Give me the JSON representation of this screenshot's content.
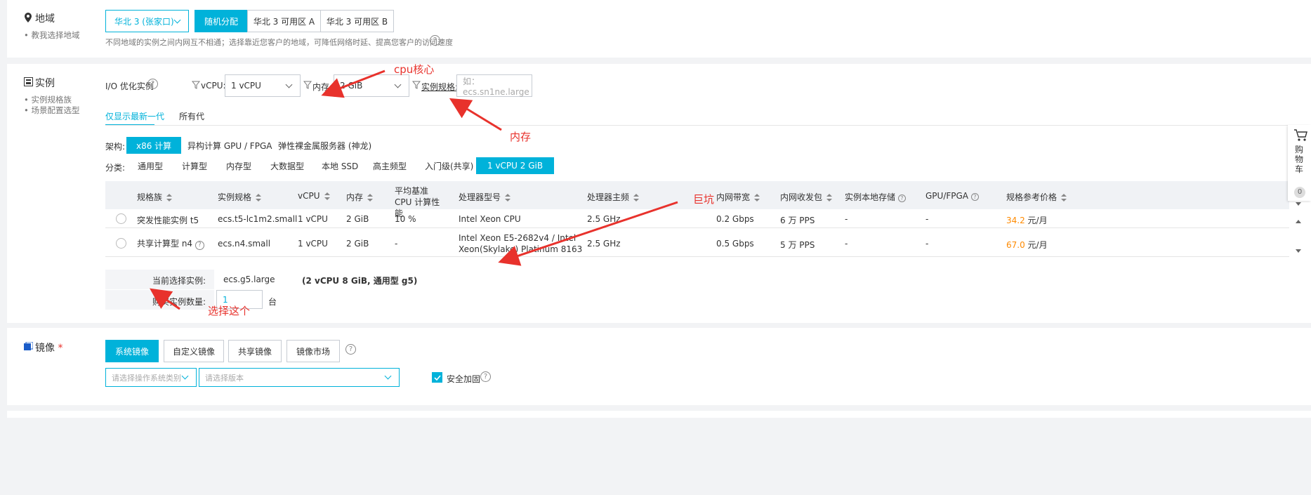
{
  "region": {
    "label": "地域",
    "help_link": "教我选择地域",
    "selected": "华北 3 (张家口)",
    "zone_buttons": [
      "随机分配",
      "华北 3 可用区 A",
      "华北 3 可用区 B"
    ],
    "note": "不同地域的实例之间内网互不相通；选择靠近您客户的地域，可降低网络时延、提高您客户的访问速度"
  },
  "instance": {
    "label": "实例",
    "side_links": [
      "实例规格族",
      "场景配置选型"
    ],
    "io_label": "I/O 优化实例",
    "vcpu_label": "vCPU:",
    "vcpu_value": "1 vCPU",
    "mem_label": "内存:",
    "mem_value": "2 GiB",
    "spec_label": "实例规格:",
    "spec_placeholder": "如：ecs.sn1ne.large",
    "gen_tabs": [
      "仅显示最新一代",
      "所有代"
    ],
    "arch_label": "架构:",
    "arch_options": [
      "x86 计算",
      "异构计算 GPU / FPGA",
      "弹性裸金属服务器 (神龙)"
    ],
    "cat_label": "分类:",
    "categories": [
      "通用型",
      "计算型",
      "内存型",
      "大数据型",
      "本地 SSD",
      "高主频型",
      "入门级(共享)",
      "1 vCPU 2 GiB"
    ],
    "table": {
      "headers": [
        "规格族",
        "实例规格",
        "vCPU",
        "内存",
        "平均基准 CPU 计算性能",
        "处理器型号",
        "处理器主频",
        "内网带宽",
        "内网收发包",
        "实例本地存储",
        "GPU/FPGA",
        "规格参考价格"
      ],
      "rows": [
        {
          "family": "突发性能实例 t5",
          "spec": "ecs.t5-lc1m2.small",
          "vcpu": "1 vCPU",
          "mem": "2 GiB",
          "perf": "10 %",
          "cpu": "Intel Xeon CPU",
          "cpu2": "",
          "freq": "2.5 GHz",
          "bw": "0.2 Gbps",
          "pps": "6 万 PPS",
          "storage": "-",
          "gpu": "-",
          "price": "34.2",
          "unit": "元/月"
        },
        {
          "family": "共享计算型 n4",
          "spec": "ecs.n4.small",
          "vcpu": "1 vCPU",
          "mem": "2 GiB",
          "perf": "-",
          "cpu": "Intel Xeon E5-2682v4 / Intel",
          "cpu2": "Xeon(Skylake) Platinum 8163",
          "freq": "2.5 GHz",
          "bw": "0.5 Gbps",
          "pps": "5 万 PPS",
          "storage": "-",
          "gpu": "-",
          "price": "67.0",
          "unit": "元/月"
        }
      ]
    },
    "current_label": "当前选择实例:",
    "current_value": "ecs.g5.large",
    "current_desc": "(2 vCPU 8 GiB, 通用型 g5)",
    "qty_label": "购买实例数量:",
    "qty_value": "1",
    "qty_unit": "台"
  },
  "image": {
    "label": "镜像",
    "required_mark": "*",
    "tabs": [
      "系统镜像",
      "自定义镜像",
      "共享镜像",
      "镜像市场"
    ],
    "os_placeholder": "请选择操作系统类别",
    "ver_placeholder": "请选择版本",
    "security_label": "安全加固"
  },
  "cart": {
    "label": "购物车",
    "count": "0"
  },
  "annotations": {
    "cpu": "cpu核心",
    "mem": "内存",
    "pit": "巨坑",
    "choose": "选择这个"
  },
  "colors": {
    "accent": "#00b2da",
    "annotation": "#e8322c",
    "price": "#ff8a00"
  }
}
